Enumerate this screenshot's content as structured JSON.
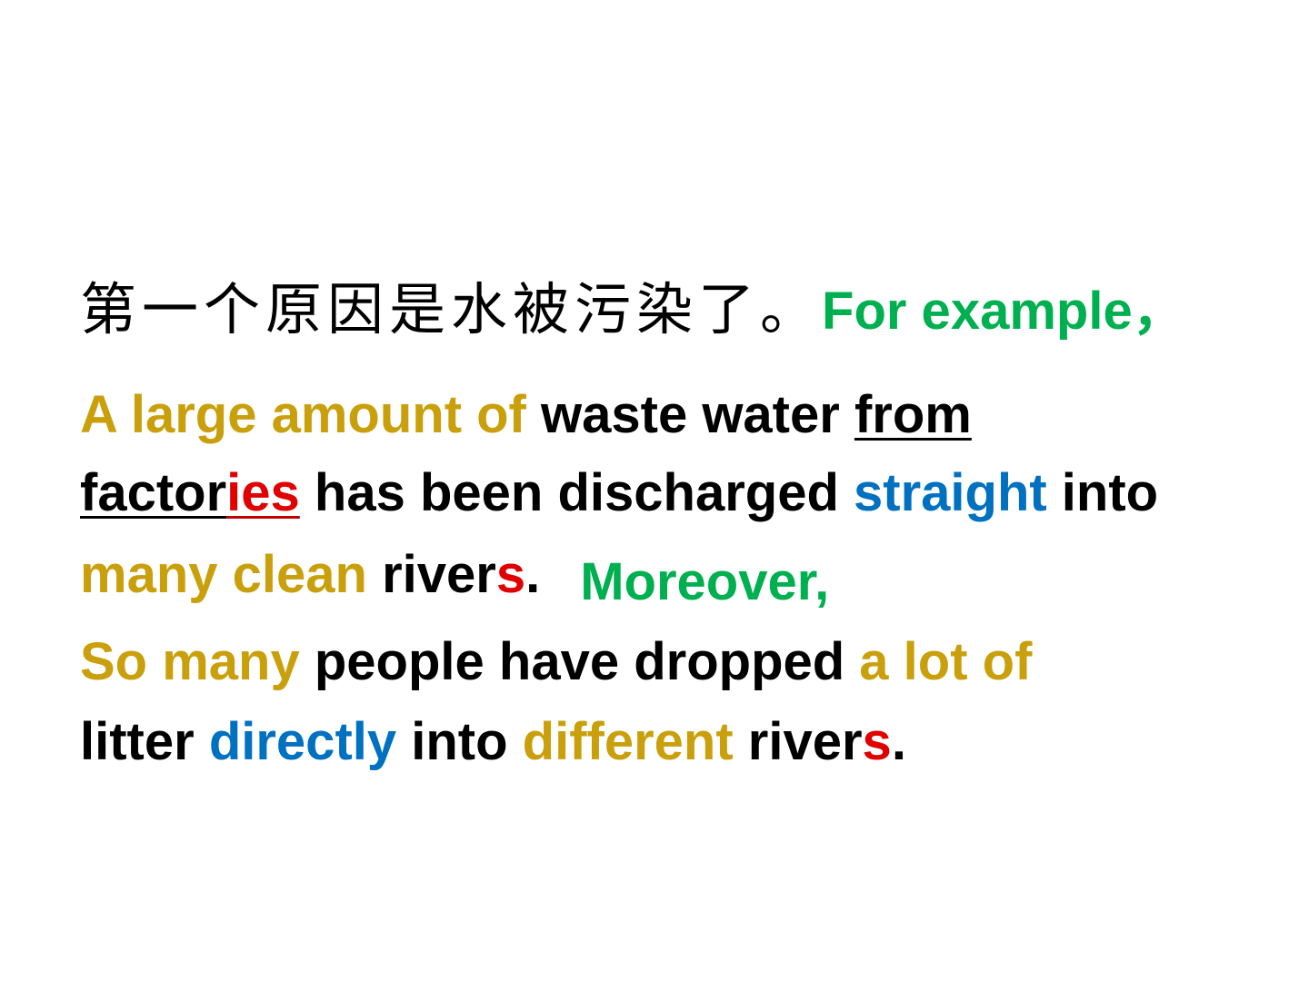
{
  "slide": {
    "line1": {
      "chinese": "第一个原因是水被污染了。",
      "for_example": "For example，"
    },
    "line2": {
      "a_large_amount_of": "A large amount of ",
      "waste_water": " waste water ",
      "from": "from"
    },
    "line3": {
      "factor": "factor",
      "ies": "ies",
      "has_been_discharged": " has been discharged ",
      "straight": "straight",
      "into": " into"
    },
    "line4": {
      "many_clean": "many clean",
      "river": " river",
      "s": "s",
      "period": ".",
      "moreover": "Moreover,"
    },
    "line5": {
      "so_many": "So many",
      "people_have_dropped": " people have dropped ",
      "a_lot_of": "a lot of"
    },
    "line6": {
      "litter": "litter ",
      "directly": "directly",
      "into": " into ",
      "different": "different",
      "river": " river",
      "s": "s",
      "period": "."
    }
  }
}
